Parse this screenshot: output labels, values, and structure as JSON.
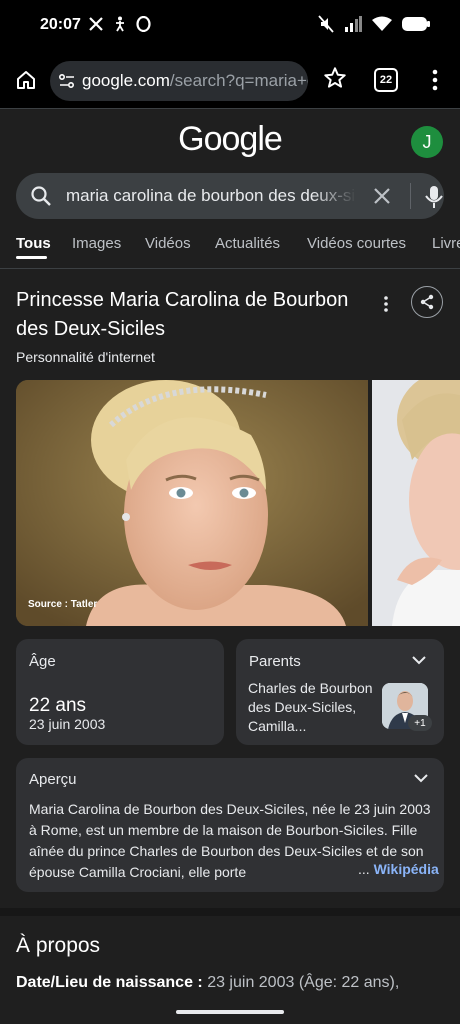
{
  "status": {
    "time": "20:07",
    "left_icons": [
      "x-logo-icon",
      "accessibility-icon",
      "opera-icon"
    ],
    "right_icons": [
      "mute-icon",
      "signal-icon",
      "wifi-icon",
      "battery-icon"
    ]
  },
  "browser": {
    "url_domain": "google.com",
    "url_rest": "/search?q=maria+c",
    "tab_count": "22"
  },
  "header": {
    "logo": "Google",
    "avatar_initial": "J"
  },
  "search": {
    "query": "maria carolina de bourbon des deux-siciles"
  },
  "tabs": [
    {
      "label": "Tous"
    },
    {
      "label": "Images"
    },
    {
      "label": "Vidéos"
    },
    {
      "label": "Actualités"
    },
    {
      "label": "Vidéos courtes"
    },
    {
      "label": "Livres"
    }
  ],
  "panel": {
    "title": "Princesse Maria Carolina de Bourbon des Deux-Siciles",
    "subtitle": "Personnalité d'internet",
    "photo_source": "Source : Tatler",
    "age": {
      "label": "Âge",
      "value": "22 ans",
      "date": "23 juin 2003"
    },
    "parents": {
      "label": "Parents",
      "text": "Charles de Bourbon des Deux-Siciles, Camilla...",
      "badge": "+1"
    },
    "overview": {
      "label": "Aperçu",
      "text": "Maria Carolina de Bourbon des Deux-Siciles, née le 23 juin 2003 à Rome, est un membre de la maison de Bourbon-Siciles. Fille aînée du prince Charles de Bourbon des Deux-Siciles et de son épouse Camilla Crociani, elle porte",
      "ellipsis": "...",
      "link": "Wikipédia"
    }
  },
  "about": {
    "title": "À propos",
    "birth_label": "Date/Lieu de naissance :",
    "birth_value": "23 juin 2003 (Âge: 22 ans),"
  }
}
